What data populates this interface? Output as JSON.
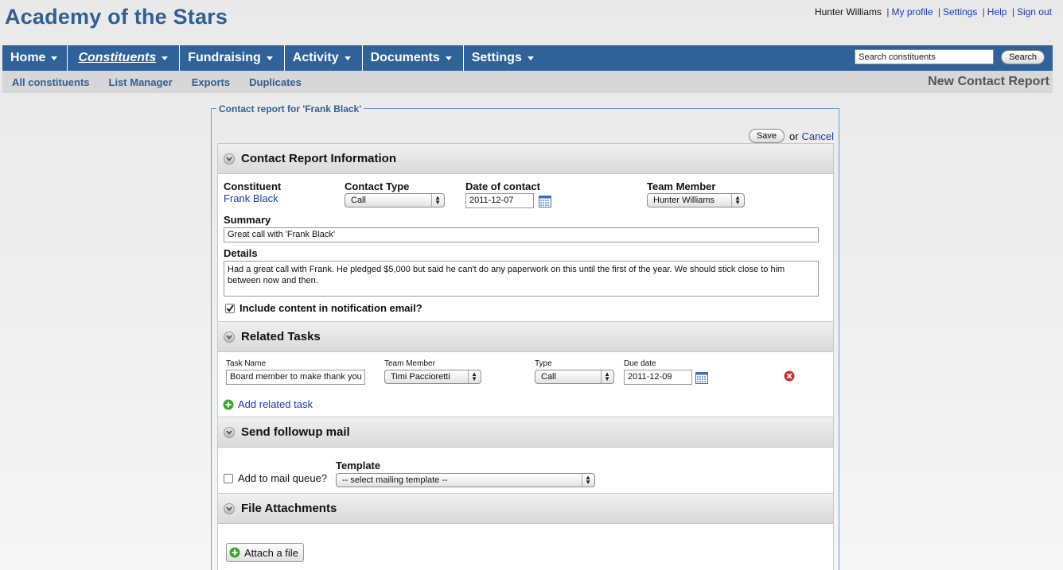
{
  "app": {
    "title": "Academy of the Stars"
  },
  "user_links": {
    "user_name": "Hunter Williams",
    "my_profile": "My profile",
    "settings": "Settings",
    "help": "Help",
    "sign_out": "Sign out",
    "separator": "|"
  },
  "nav": {
    "items": [
      {
        "label": "Home"
      },
      {
        "label": "Constituents"
      },
      {
        "label": "Fundraising"
      },
      {
        "label": "Activity"
      },
      {
        "label": "Documents"
      },
      {
        "label": "Settings"
      }
    ],
    "search_placeholder": "Search constituents",
    "search_button": "Search"
  },
  "subnav": {
    "items": [
      {
        "label": "All constituents"
      },
      {
        "label": "List Manager"
      },
      {
        "label": "Exports"
      },
      {
        "label": "Duplicates"
      }
    ],
    "page_heading": "New Contact Report"
  },
  "form": {
    "legend": "Contact report for 'Frank Black'",
    "save_label": "Save",
    "or_text": "or",
    "cancel_label": "Cancel"
  },
  "contact_info": {
    "header": "Contact Report Information",
    "constituent_label": "Constituent",
    "constituent_value": "Frank Black",
    "contact_type_label": "Contact Type",
    "contact_type_value": "Call",
    "date_label": "Date of contact",
    "date_value": "2011-12-07",
    "team_member_label": "Team Member",
    "team_member_value": "Hunter Williams",
    "summary_label": "Summary",
    "summary_value": "Great call with 'Frank Black'",
    "details_label": "Details",
    "details_value": "Had a great call with Frank. He pledged $5,000 but said he can't do any paperwork on this until the first of the year. We should stick close to him between now and then.",
    "include_label": "Include content in notification email?",
    "include_checked": true
  },
  "related_tasks": {
    "header": "Related Tasks",
    "columns": {
      "task_name": "Task Name",
      "team_member": "Team Member",
      "type": "Type",
      "due_date": "Due date"
    },
    "rows": [
      {
        "task_name": "Board member to make thank you",
        "team_member": "Timi Paccioretti",
        "type": "Call",
        "due_date": "2011-12-09"
      }
    ],
    "add_label": "Add related task"
  },
  "followup": {
    "header": "Send followup mail",
    "queue_label": "Add to mail queue?",
    "template_label": "Template",
    "template_value": "-- select mailing template --"
  },
  "attachments": {
    "header": "File Attachments",
    "attach_label": "Attach a file"
  },
  "colors": {
    "brand_blue": "#2e6299",
    "title_blue": "#2e5f96",
    "link_blue": "#1a3bb0",
    "delete_red": "#d42b2b",
    "add_green": "#3aa630"
  },
  "icons": [
    "chevron-down-icon",
    "calendar-icon",
    "delete-icon",
    "add-icon",
    "checkmark-icon"
  ]
}
